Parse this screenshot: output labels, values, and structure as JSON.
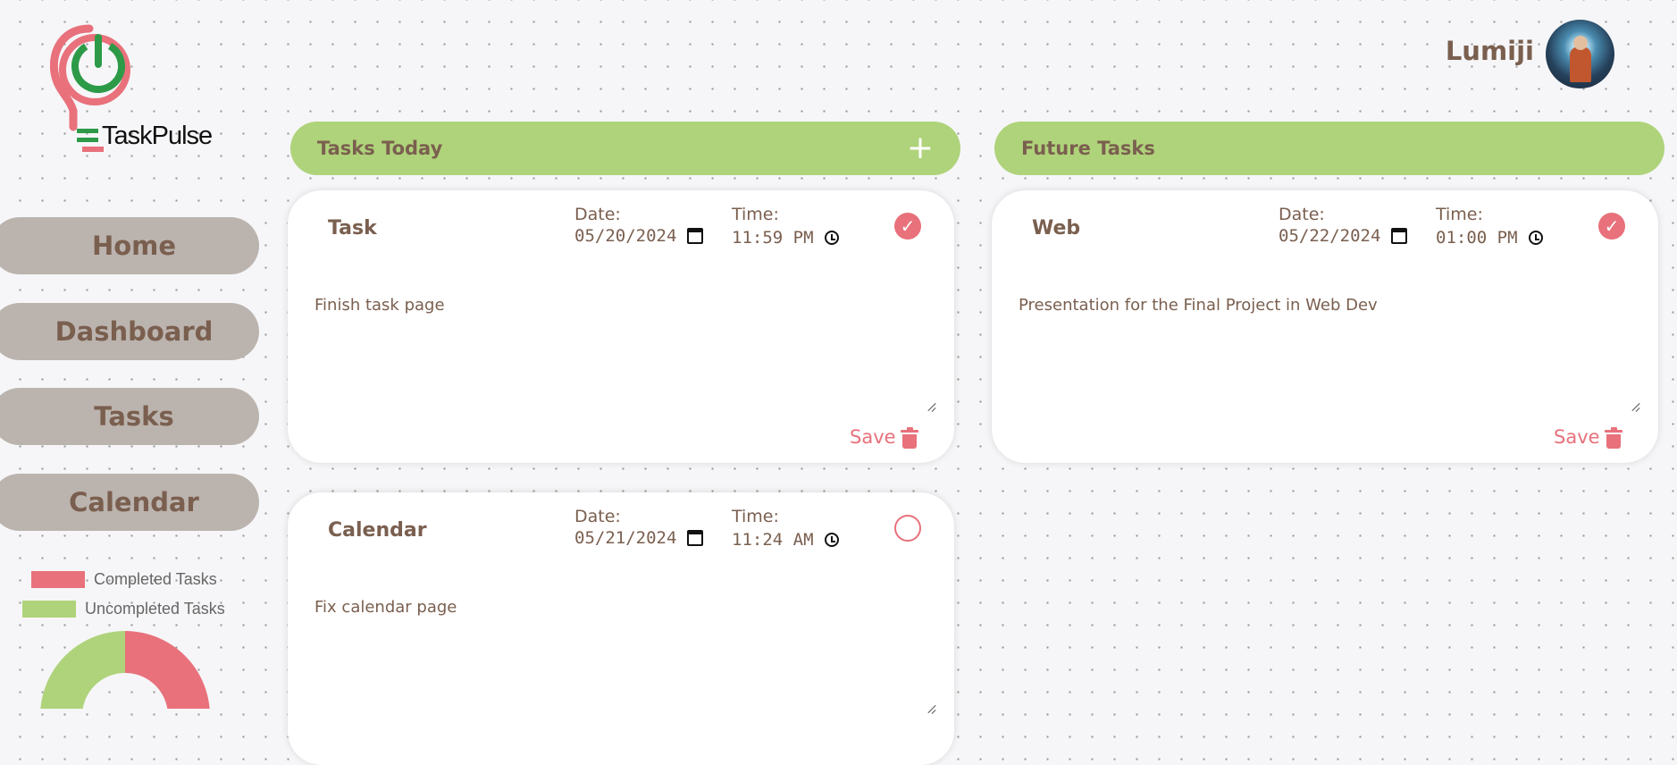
{
  "brand": {
    "name": "TaskPulse",
    "logo_icon": "power-bulb-icon"
  },
  "user": {
    "name": "Lumiji",
    "avatar_icon": "user-avatar"
  },
  "nav": [
    {
      "label": "Home"
    },
    {
      "label": "Dashboard"
    },
    {
      "label": "Tasks"
    },
    {
      "label": "Calendar"
    }
  ],
  "chart_data": {
    "type": "pie",
    "labels": [
      "Completed Tasks",
      "Uncompleted Tasks"
    ],
    "values": [
      2,
      1
    ],
    "colors": [
      "#e8717b",
      "#afd37a"
    ]
  },
  "sections": {
    "today": {
      "title": "Tasks Today",
      "add_icon": "plus-icon"
    },
    "future": {
      "title": "Future Tasks"
    }
  },
  "tasks": [
    {
      "title": "Task",
      "date_label": "Date:",
      "date": "05/20/2024",
      "time_label": "Time:",
      "time": "11:59 PM",
      "completed": true,
      "description": "Finish task page",
      "save_label": "Save"
    },
    {
      "title": "Web",
      "date_label": "Date:",
      "date": "05/22/2024",
      "time_label": "Time:",
      "time": "01:00 PM",
      "completed": true,
      "description": "Presentation for the Final Project in Web Dev",
      "save_label": "Save"
    },
    {
      "title": "Calendar",
      "date_label": "Date:",
      "date": "05/21/2024",
      "time_label": "Time:",
      "time": "11:24 AM",
      "completed": false,
      "description": "Fix calendar page",
      "save_label": "Save"
    }
  ],
  "colors": {
    "accent_green": "#afd37a",
    "accent_red": "#e8717b",
    "text_brown": "#7a5f4f",
    "nav_bg": "#bbb3ae"
  }
}
